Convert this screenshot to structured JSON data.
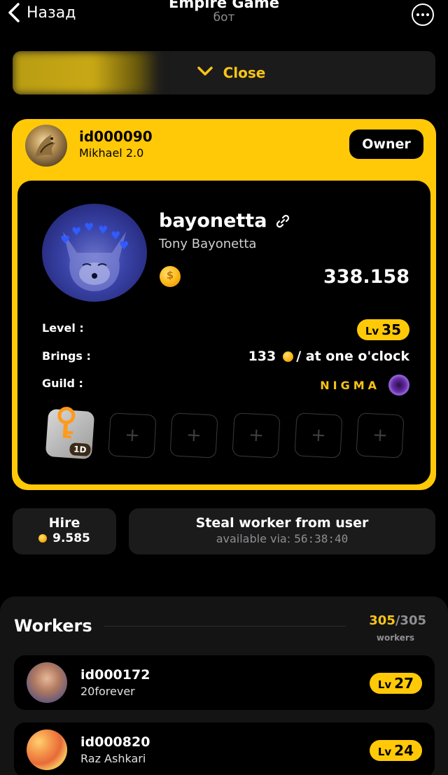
{
  "header": {
    "back_label": "Назад",
    "title": "Empire Game",
    "subtitle": "бот"
  },
  "collapse": {
    "label": "Close"
  },
  "owner": {
    "id": "id000090",
    "name": "Mikhael 2.0",
    "badge": "Owner"
  },
  "profile": {
    "username": "bayonetta",
    "full_name": "Tony Bayonetta",
    "balance": "338.158",
    "level_label": "Level :",
    "level_prefix": "Lv",
    "level": "35",
    "brings_label": "Brings :",
    "brings_amount": "133",
    "brings_suffix": "/ at one o'clock",
    "guild_label": "Guild :",
    "guild_name": "NIGMA",
    "item_duration": "1D",
    "empty_slot_symbol": "+"
  },
  "actions": {
    "hire_label": "Hire",
    "hire_price": "9.585",
    "steal_label": "Steal worker from user",
    "steal_available_prefix": "available via:",
    "steal_timer": "56:38:40"
  },
  "workers": {
    "title": "Workers",
    "current": "305",
    "total": "/305",
    "unit": "workers",
    "items": [
      {
        "id": "id000172",
        "name": "20forever",
        "level_prefix": "Lv",
        "level": "27"
      },
      {
        "id": "id000820",
        "name": "Raz Ashkari",
        "level_prefix": "Lv",
        "level": "24"
      }
    ]
  },
  "colors": {
    "accent": "#ffc908",
    "background": "#000000",
    "panel": "#1b1b1b",
    "muted_text": "#8e8e93"
  }
}
